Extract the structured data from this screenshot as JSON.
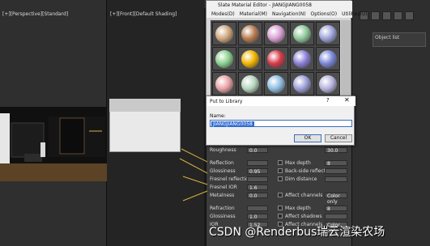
{
  "viewports": {
    "left_label": "[+][Perspective][Standard]",
    "center_label": "[+][Front][Default Shading]"
  },
  "material_editor": {
    "title": "Slate Material Editor - JIANGJIANG0058",
    "menus": [
      "Modes(D)",
      "Material(M)",
      "Navigation(N)",
      "Options(O)",
      "Utilities(U)"
    ],
    "slots": [
      {
        "color": "#cfa87e"
      },
      {
        "color": "#b97c52"
      },
      {
        "color": "#d9a0d2"
      },
      {
        "color": "#8fc89a"
      },
      {
        "color": "#9da3d8"
      },
      {
        "color": "#8bd08e"
      },
      {
        "color": "#f0b400"
      },
      {
        "color": "#d83a4a"
      },
      {
        "color": "#8a7fd6"
      },
      {
        "color": "#7a86d8"
      },
      {
        "color": "#e9a3a6"
      },
      {
        "color": "#b7d6bf"
      },
      {
        "color": "#8fbde0"
      },
      {
        "color": "#9d9fd8"
      },
      {
        "color": "#b7b2dc"
      }
    ]
  },
  "dialog": {
    "title": "Put to Library",
    "help": "?",
    "close": "✕",
    "name_label": "Name:",
    "name_value": "JIANGJIANG0058",
    "ok_label": "OK",
    "cancel_label": "Cancel"
  },
  "params": {
    "rows": [
      {
        "label": "Roughness",
        "value": "0.0"
      },
      {
        "label": "Reflection",
        "value": ""
      },
      {
        "label": "Glossiness",
        "value": "0.95"
      },
      {
        "label": "Fresnel reflections",
        "value": ""
      },
      {
        "label": "Fresnel IOR",
        "value": "1.6"
      },
      {
        "label": "Metalness",
        "value": "0.0"
      },
      {
        "label": "Refraction",
        "value": ""
      },
      {
        "label": "Glossiness",
        "value": "1.0"
      },
      {
        "label": "IOR",
        "value": "1.52"
      }
    ],
    "right_rows": [
      {
        "label": "Max depth",
        "value": "8"
      },
      {
        "label": "Back-side reflect",
        "value": ""
      },
      {
        "label": "Dim distance",
        "value": ""
      },
      {
        "label": "Affect channels",
        "value": "Color only"
      },
      {
        "label": "Max depth",
        "value": "8"
      },
      {
        "label": "Affect shadows",
        "value": ""
      },
      {
        "label": "Affect channels",
        "value": "Color only"
      }
    ],
    "diffuse_value": "30.0"
  },
  "right_panel": {
    "list_label": "Object list"
  },
  "watermark": "CSDN @Renderbus瑞云渲染农场",
  "colors": {
    "callout": "#d9b23a",
    "accent": "#2f6ad2"
  }
}
